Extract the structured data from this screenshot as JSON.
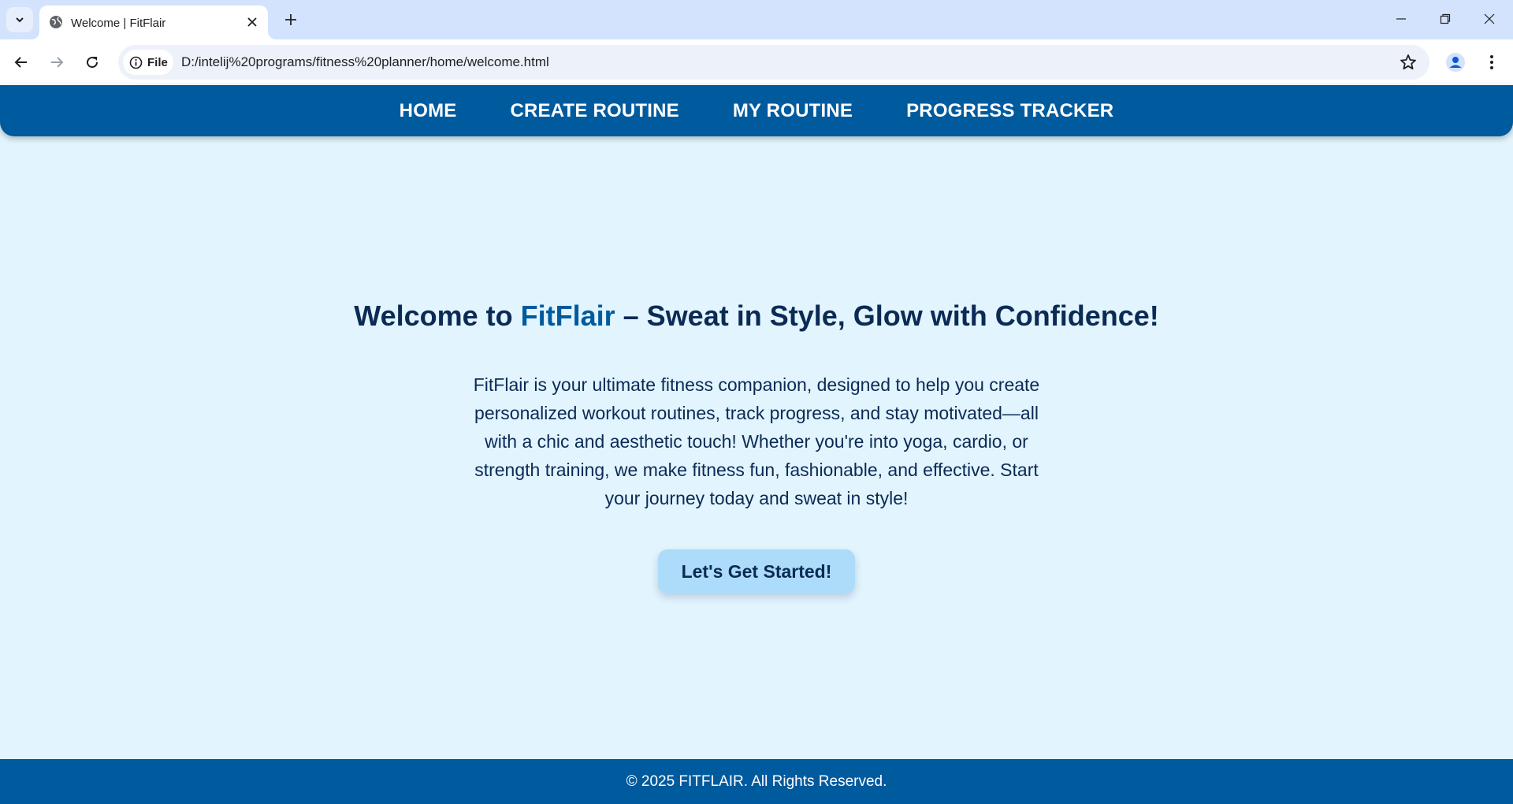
{
  "browser": {
    "tab_title": "Welcome | FitFlair",
    "omnibox_chip": "File",
    "url": "D:/intelij%20programs/fitness%20planner/home/welcome.html"
  },
  "nav": {
    "items": [
      {
        "label": "HOME"
      },
      {
        "label": "CREATE ROUTINE"
      },
      {
        "label": "MY ROUTINE"
      },
      {
        "label": "PROGRESS TRACKER"
      }
    ]
  },
  "hero": {
    "title_prefix": "Welcome to ",
    "title_brand": "FitFlair",
    "title_suffix": " – Sweat in Style, Glow with Confidence!",
    "description": "FitFlair is your ultimate fitness companion, designed to help you create personalized workout routines, track progress, and stay motivated—all with a chic and aesthetic touch! Whether you're into yoga, cardio, or strength training, we make fitness fun, fashionable, and effective. Start your journey today and sweat in style!",
    "cta_label": "Let's Get Started!"
  },
  "footer": {
    "text": "© 2025 FITFLAIR. All Rights Reserved."
  },
  "colors": {
    "primary": "#005a9e",
    "page_background": "#e2f4fd",
    "heading_text": "#0b2a55",
    "button_background": "#acdcfa"
  }
}
